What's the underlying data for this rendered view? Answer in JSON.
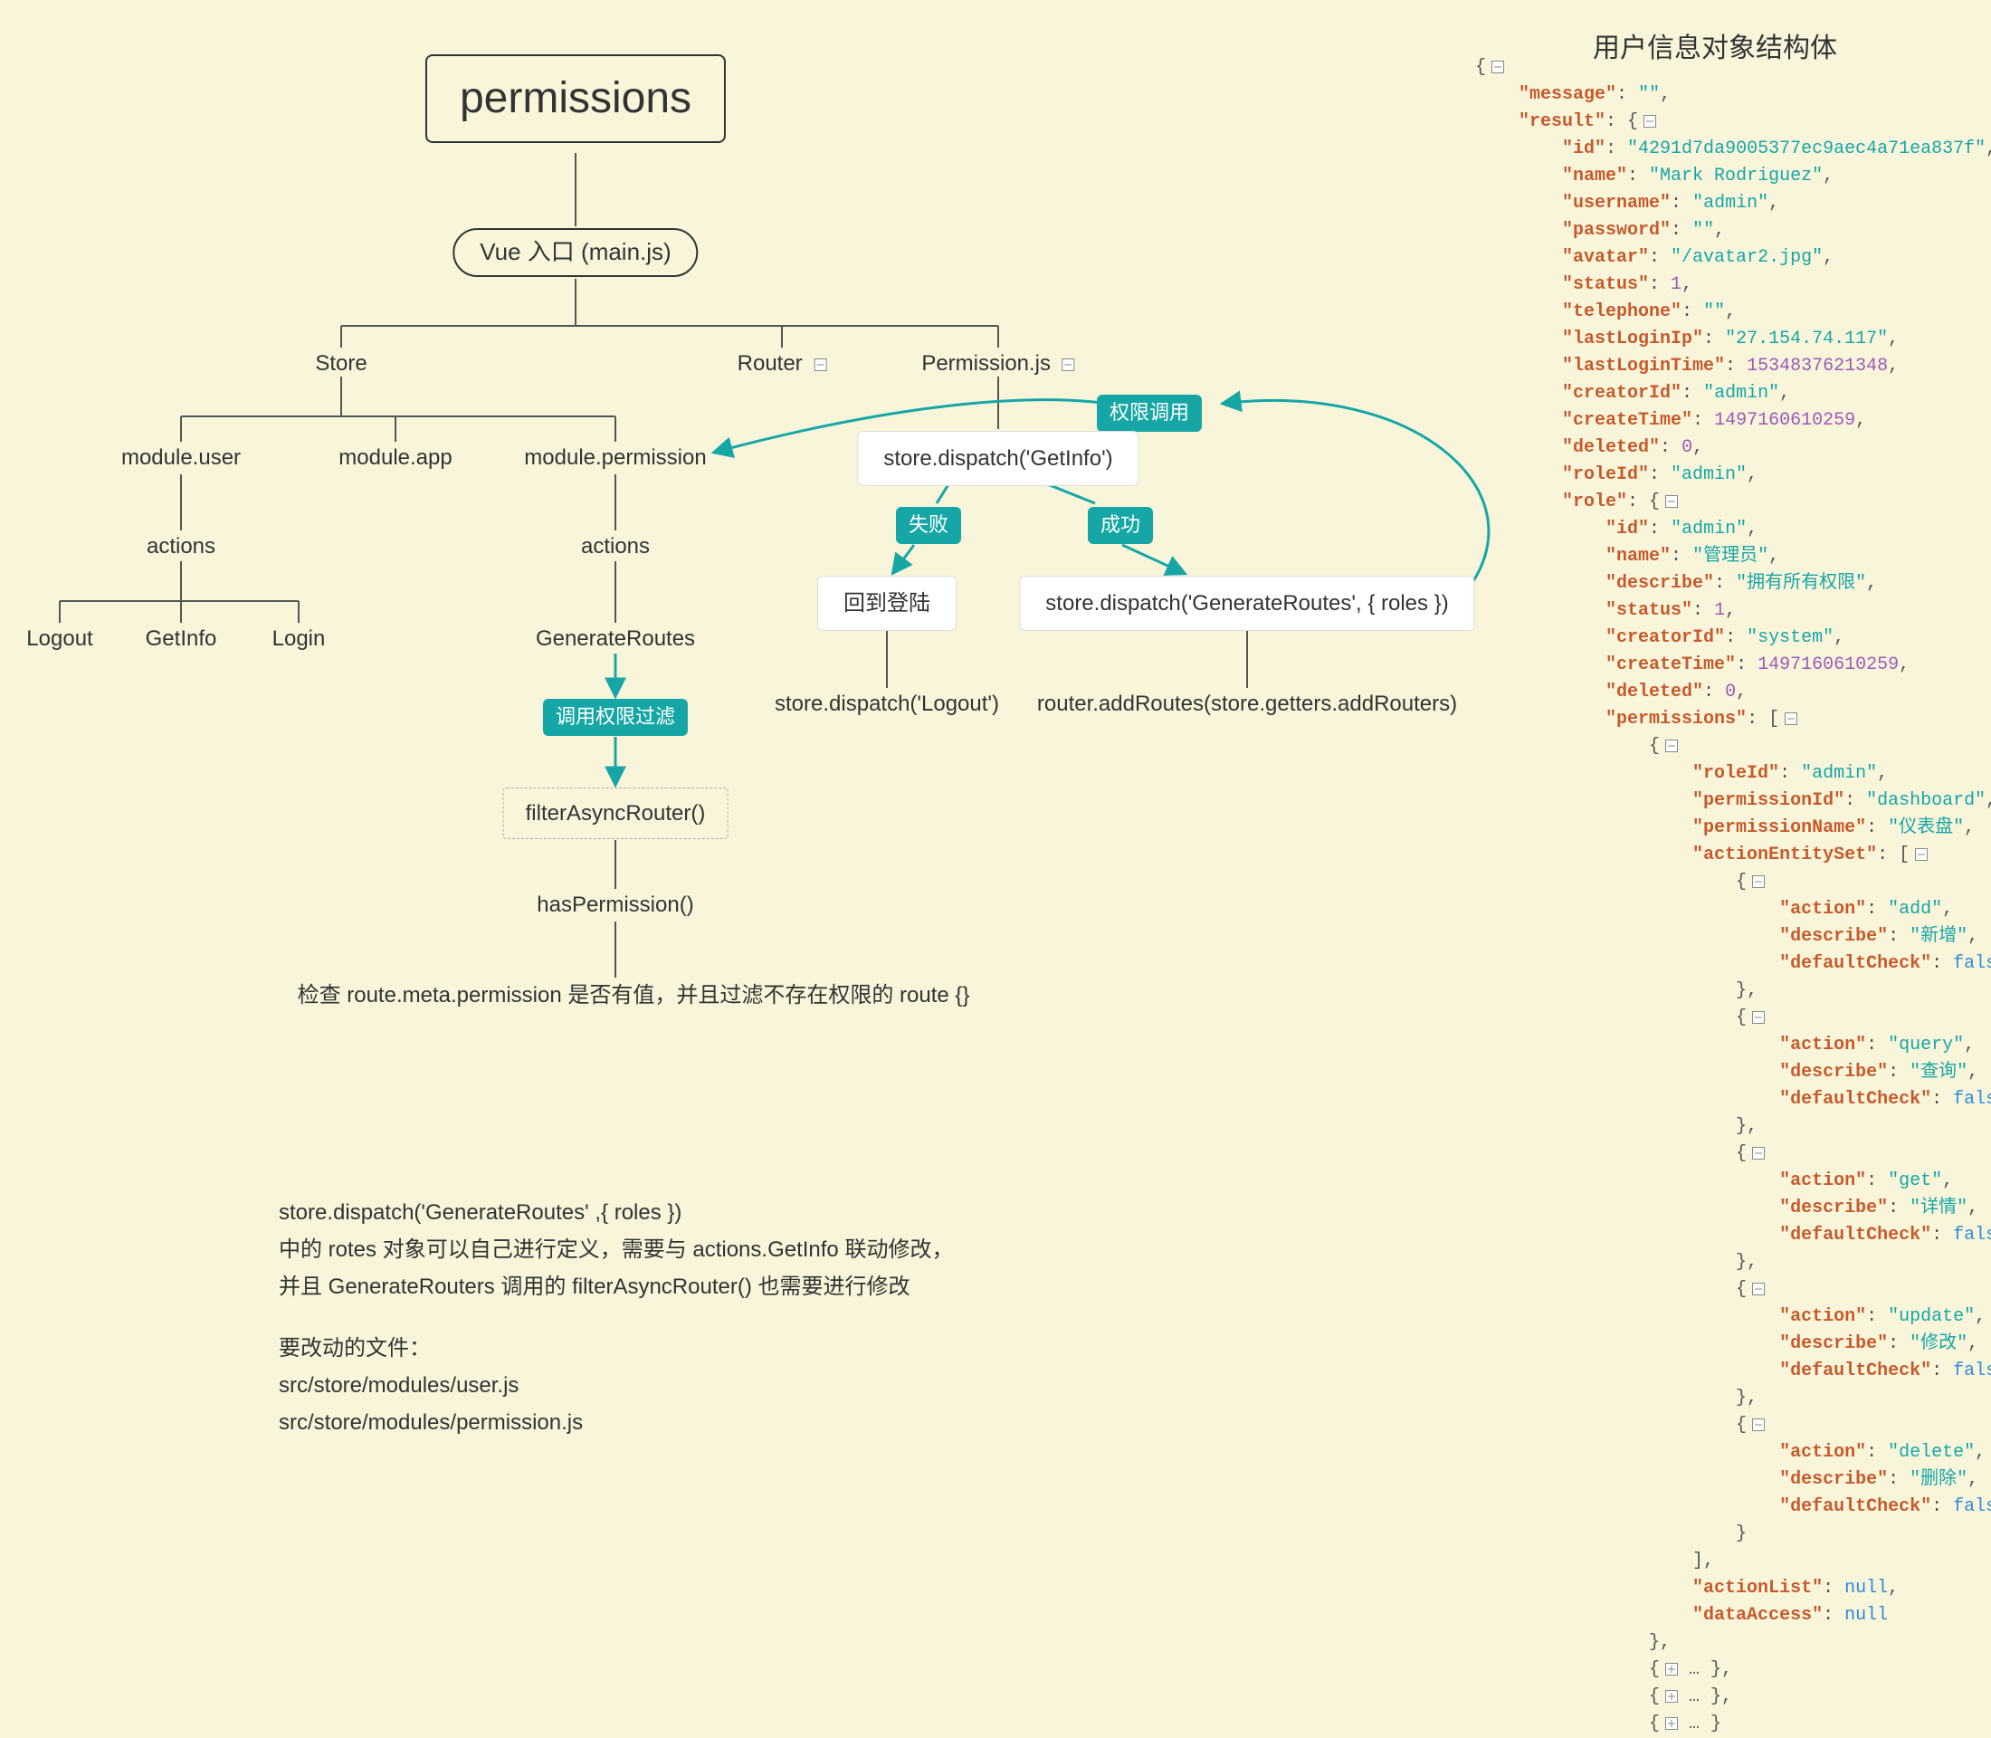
{
  "diagram": {
    "title": "permissions",
    "entry": "Vue 入口 (main.js)",
    "storeLabel": "Store",
    "routerLabel": "Router",
    "permissionJsLabel": "Permission.js",
    "moduleUser": "module.user",
    "moduleApp": "module.app",
    "modulePermission": "module.permission",
    "actions1": "actions",
    "actions2": "actions",
    "logout": "Logout",
    "getInfo": "GetInfo",
    "login": "Login",
    "generateRoutes": "GenerateRoutes",
    "callFilterTag": "调用权限过滤",
    "filterAsyncRouter": "filterAsyncRouter()",
    "hasPermission": "hasPermission()",
    "checkRoute": "检查 route.meta.permission 是否有值，并且过滤不存在权限的 route {}",
    "permCallTag": "权限调用",
    "dispatchGetInfo": "store.dispatch('GetInfo')",
    "failTag": "失败",
    "successTag": "成功",
    "backLogin": "回到登陆",
    "dispatchGenerateRoutes": "store.dispatch('GenerateRoutes', { roles })",
    "dispatchLogout": "store.dispatch('Logout')",
    "addRoutes": "router.addRoutes(store.getters.addRouters)"
  },
  "notes": {
    "l1": "store.dispatch('GenerateRoutes' ,{ roles })",
    "l2": "中的 rotes 对象可以自己进行定义，需要与 actions.GetInfo 联动修改，",
    "l3": "并且 GenerateRouters 调用的  filterAsyncRouter() 也需要进行修改",
    "l4": "要改动的文件：",
    "l5": "src/store/modules/user.js",
    "l6": "src/store/modules/permission.js"
  },
  "jsonPanel": {
    "title": "用户信息对象结构体",
    "message": "",
    "result": {
      "id": "4291d7da9005377ec9aec4a71ea837f",
      "name": "Mark Rodriguez",
      "username": "admin",
      "password": "",
      "avatar": "/avatar2.jpg",
      "status": 1,
      "telephone": "",
      "lastLoginIp": "27.154.74.117",
      "lastLoginTime": 1534837621348,
      "creatorId": "admin",
      "createTime": 1497160610259,
      "deleted": 0,
      "roleId": "admin",
      "role": {
        "id": "admin",
        "name": "管理员",
        "describe": "拥有所有权限",
        "status": 1,
        "creatorId": "system",
        "createTime": 1497160610259,
        "deleted": 0,
        "permissions": [
          {
            "roleId": "admin",
            "permissionId": "dashboard",
            "permissionName": "仪表盘",
            "actionEntitySet": [
              {
                "action": "add",
                "describe": "新增",
                "defaultCheck": false
              },
              {
                "action": "query",
                "describe": "查询",
                "defaultCheck": false
              },
              {
                "action": "get",
                "describe": "详情",
                "defaultCheck": false
              },
              {
                "action": "update",
                "describe": "修改",
                "defaultCheck": false
              },
              {
                "action": "delete",
                "describe": "删除",
                "defaultCheck": false
              }
            ],
            "actionList": null,
            "dataAccess": null
          }
        ],
        "collapsedExtra": 3
      }
    }
  }
}
